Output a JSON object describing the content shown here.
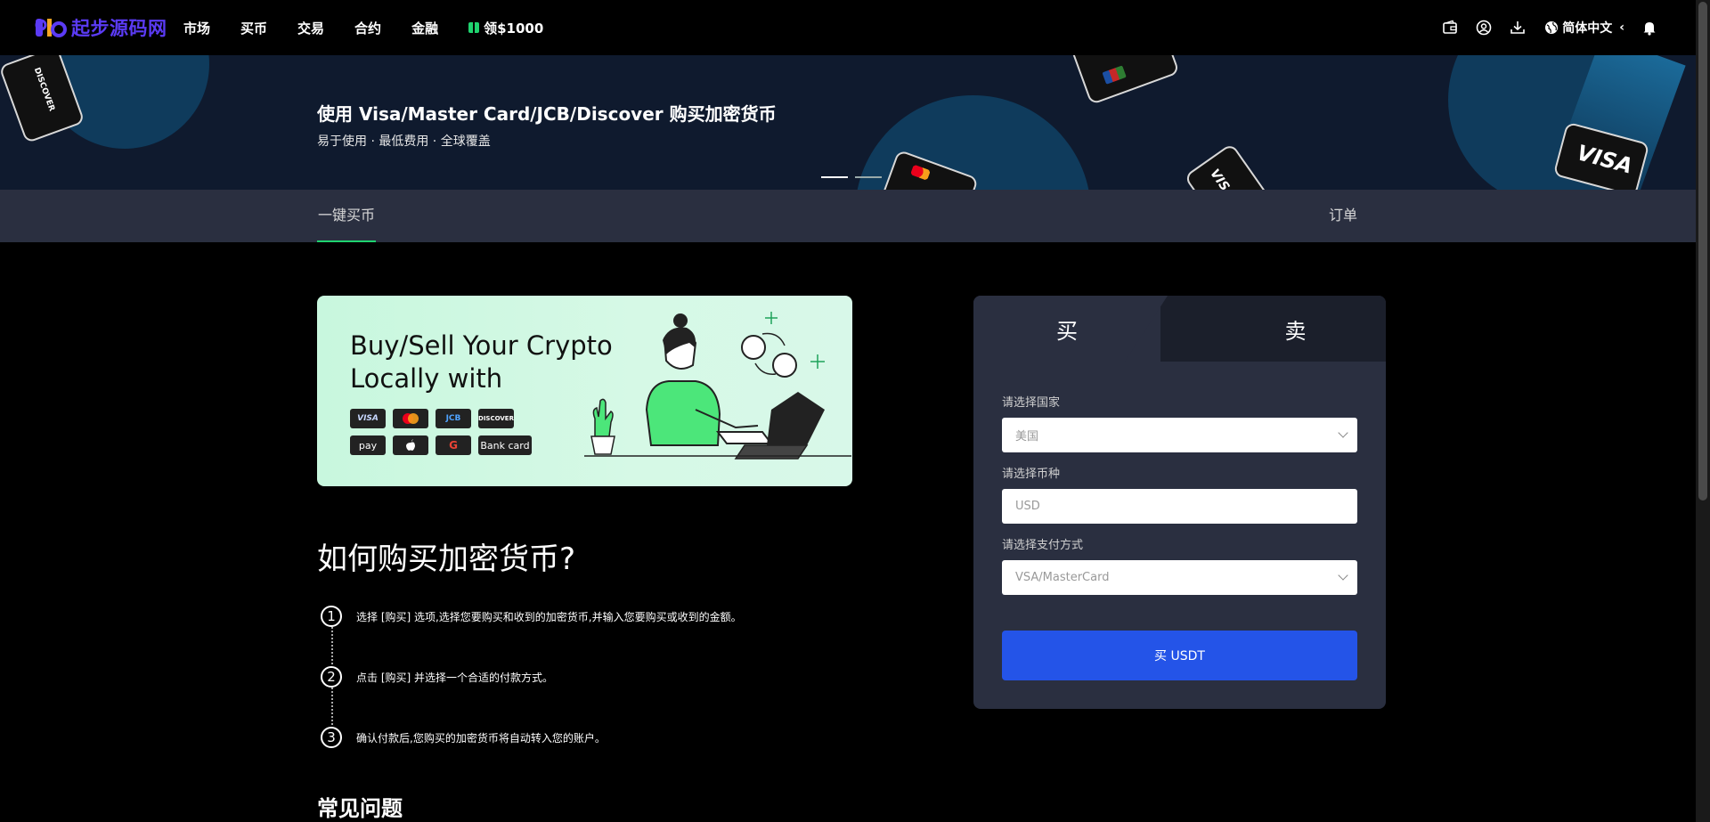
{
  "brand": {
    "name": "起步源码网",
    "color": "#5b3bf5"
  },
  "nav": {
    "items": [
      "市场",
      "买币",
      "交易",
      "合约",
      "金融"
    ],
    "gift_label": "领$1000",
    "language": "简体中文"
  },
  "banner": {
    "title": "使用 Visa/Master Card/JCB/Discover 购买加密货币",
    "subtitle": "易于使用 · 最低费用 · 全球覆盖",
    "card_labels": {
      "visa": "VISA",
      "discover": "DISCOVER"
    }
  },
  "tabs": {
    "buy": "一键买币",
    "orders": "订单"
  },
  "promo": {
    "title_line1": "Buy/Sell Your Crypto",
    "title_line2": "Locally with",
    "payments": [
      "VISA",
      "",
      "JCB",
      "DISCOVER",
      "pay",
      "",
      "G",
      "Bank card"
    ]
  },
  "how": {
    "title": "如何购买加密货币?",
    "steps": [
      {
        "num": "1",
        "text": "选择 [购买] 选项,选择您要购买和收到的加密货币,并输入您要购买或收到的金额。"
      },
      {
        "num": "2",
        "text": "点击 [购买] 并选择一个合适的付款方式。"
      },
      {
        "num": "3",
        "text": "确认付款后,您购买的加密货币将自动转入您的账户。"
      }
    ]
  },
  "faq": {
    "title": "常见问题"
  },
  "panel": {
    "tab_buy": "买",
    "tab_sell": "卖",
    "country_label": "请选择国家",
    "country_value": "美国",
    "currency_label": "请选择币种",
    "currency_value": "USD",
    "payment_label": "请选择支付方式",
    "payment_value": "VSA/MasterCard",
    "submit": "买 USDT"
  },
  "colors": {
    "accent_green": "#1fd36f",
    "button_blue": "#2454e8",
    "panel_bg": "#2a2f40"
  }
}
